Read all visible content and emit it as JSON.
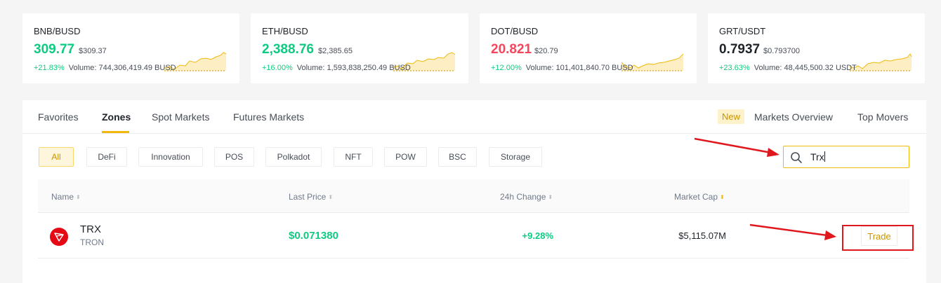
{
  "tickers": [
    {
      "pair": "BNB/BUSD",
      "price": "309.77",
      "usd": "$309.37",
      "change": "+21.83%",
      "volume": "Volume: 744,306,419.49 BUSD",
      "price_color": "#0ecb81"
    },
    {
      "pair": "ETH/BUSD",
      "price": "2,388.76",
      "usd": "$2,385.65",
      "change": "+16.00%",
      "volume": "Volume: 1,593,838,250.49 BUSD",
      "price_color": "#0ecb81"
    },
    {
      "pair": "DOT/BUSD",
      "price": "20.821",
      "usd": "$20.79",
      "change": "+12.00%",
      "volume": "Volume: 101,401,840.70 BUSD",
      "price_color": "#f6465d"
    },
    {
      "pair": "GRT/USDT",
      "price": "0.7937",
      "usd": "$0.793700",
      "change": "+23.63%",
      "volume": "Volume: 48,445,500.32 USDT",
      "price_color": "#1e2329"
    }
  ],
  "tabs": {
    "favorites": "Favorites",
    "zones": "Zones",
    "spot": "Spot Markets",
    "futures": "Futures Markets",
    "new_badge": "New",
    "overview": "Markets Overview",
    "movers": "Top Movers"
  },
  "chips": [
    "All",
    "DeFi",
    "Innovation",
    "POS",
    "Polkadot",
    "NFT",
    "POW",
    "BSC",
    "Storage"
  ],
  "search": {
    "value": "Trx"
  },
  "table": {
    "headers": {
      "name": "Name",
      "price": "Last Price",
      "change": "24h Change",
      "cap": "Market Cap"
    },
    "rows": [
      {
        "symbol": "TRX",
        "name": "TRON",
        "price": "$0.071380",
        "change": "+9.28%",
        "cap": "$5,115.07M",
        "action": "Trade"
      }
    ]
  },
  "colors": {
    "accent": "#f0b90b",
    "up": "#0ecb81",
    "down": "#f6465d",
    "annotation": "#e1171e"
  },
  "icons": {
    "search": "search-icon",
    "coin": "tron-logo-icon",
    "sort": "sort-arrows-icon"
  }
}
